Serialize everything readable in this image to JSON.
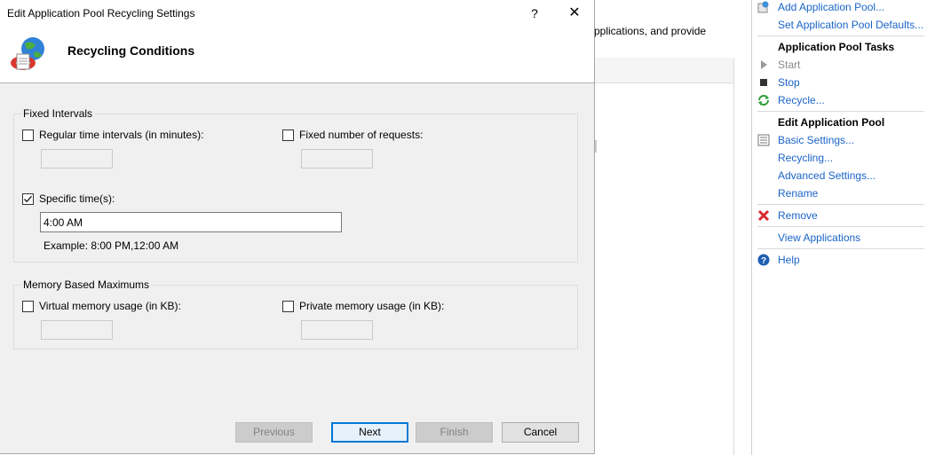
{
  "background": {
    "description_fragment": "pplications, and provide"
  },
  "actions_pane": {
    "top_links": [
      {
        "label": "Add Application Pool..."
      },
      {
        "label": "Set Application Pool Defaults..."
      }
    ],
    "pool_tasks_heading": "Application Pool Tasks",
    "pool_tasks": [
      {
        "label": "Start",
        "icon": "play-icon",
        "enabled": false
      },
      {
        "label": "Stop",
        "icon": "stop-icon",
        "enabled": true
      },
      {
        "label": "Recycle...",
        "icon": "recycle-icon",
        "enabled": true
      }
    ],
    "edit_heading": "Edit Application Pool",
    "edit_items": [
      {
        "label": "Basic Settings...",
        "icon": "settings-list-icon"
      },
      {
        "label": "Recycling..."
      },
      {
        "label": "Advanced Settings..."
      },
      {
        "label": "Rename"
      }
    ],
    "remove_label": "Remove",
    "view_apps_label": "View Applications",
    "help_label": "Help",
    "colors": {
      "link": "#1a64c8",
      "remove_icon": "#d9272e",
      "help_icon": "#1f5fb4"
    }
  },
  "dialog": {
    "title": "Edit Application Pool Recycling Settings",
    "help_glyph": "?",
    "close_glyph": "✕",
    "banner_title": "Recycling Conditions",
    "fixed_intervals": {
      "title": "Fixed Intervals",
      "regular_time": {
        "label": "Regular time intervals (in minutes):",
        "checked": false,
        "value": ""
      },
      "fixed_requests": {
        "label": "Fixed number of requests:",
        "checked": false,
        "value": ""
      },
      "specific_time": {
        "label": "Specific time(s):",
        "checked": true,
        "value": "4:00 AM"
      },
      "example": "Example: 8:00 PM,12:00 AM"
    },
    "memory_maximums": {
      "title": "Memory Based Maximums",
      "virtual_memory": {
        "label": "Virtual memory usage (in KB):",
        "checked": false,
        "value": ""
      },
      "private_memory": {
        "label": "Private memory usage (in KB):",
        "checked": false,
        "value": ""
      }
    },
    "buttons": {
      "previous": "Previous",
      "next": "Next",
      "finish": "Finish",
      "cancel": "Cancel"
    }
  }
}
